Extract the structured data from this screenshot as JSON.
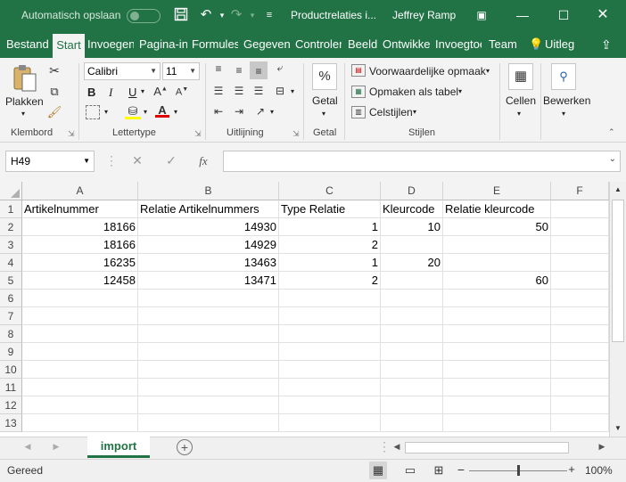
{
  "titlebar": {
    "autosave_label": "Automatisch opslaan",
    "file_title": "Productrelaties i...",
    "user": "Jeffrey Ramp",
    "save_icon": "save-icon",
    "undo_icon": "undo-icon",
    "redo_icon": "redo-icon"
  },
  "tabs": [
    "Bestand",
    "Start",
    "Invoegen",
    "Pagina-in",
    "Formules",
    "Gegevens",
    "Controler",
    "Beeld",
    "Ontwikke",
    "Invoegtoe",
    "Team"
  ],
  "tell_me": "Uitleg",
  "ribbon": {
    "clipboard": {
      "label": "Klembord",
      "paste": "Plakken"
    },
    "font": {
      "label": "Lettertype",
      "name": "Calibri",
      "size": "11",
      "bold": "B",
      "italic": "I",
      "underline": "U"
    },
    "alignment": {
      "label": "Uitlijning"
    },
    "number": {
      "label": "Getal",
      "percent": "%"
    },
    "styles": {
      "label": "Stijlen",
      "conditional": "Voorwaardelijke opmaak",
      "as_table": "Opmaken als tabel",
      "cell_styles": "Celstijlen"
    },
    "cells": {
      "label": "Cellen"
    },
    "editing": {
      "label": "Bewerken"
    }
  },
  "formula_bar": {
    "name_box": "H49",
    "fx": "fx",
    "value": ""
  },
  "columns": [
    "A",
    "B",
    "C",
    "D",
    "E",
    "F"
  ],
  "rows": [
    "1",
    "2",
    "3",
    "4",
    "5",
    "6",
    "7",
    "8",
    "9",
    "10",
    "11",
    "12",
    "13"
  ],
  "table": [
    [
      "Artikelnummer",
      "Relatie Artikelnummers",
      "Type Relatie",
      "Kleurcode",
      "Relatie kleurcode",
      ""
    ],
    [
      "18166",
      "14930",
      "1",
      "10",
      "50",
      ""
    ],
    [
      "18166",
      "14929",
      "2",
      "",
      "",
      ""
    ],
    [
      "16235",
      "13463",
      "1",
      "20",
      "",
      ""
    ],
    [
      "12458",
      "13471",
      "2",
      "",
      "60",
      ""
    ]
  ],
  "sheet": {
    "tab": "import"
  },
  "status": {
    "ready": "Gereed",
    "zoom": "100%"
  },
  "colors": {
    "accent": "#217346"
  }
}
